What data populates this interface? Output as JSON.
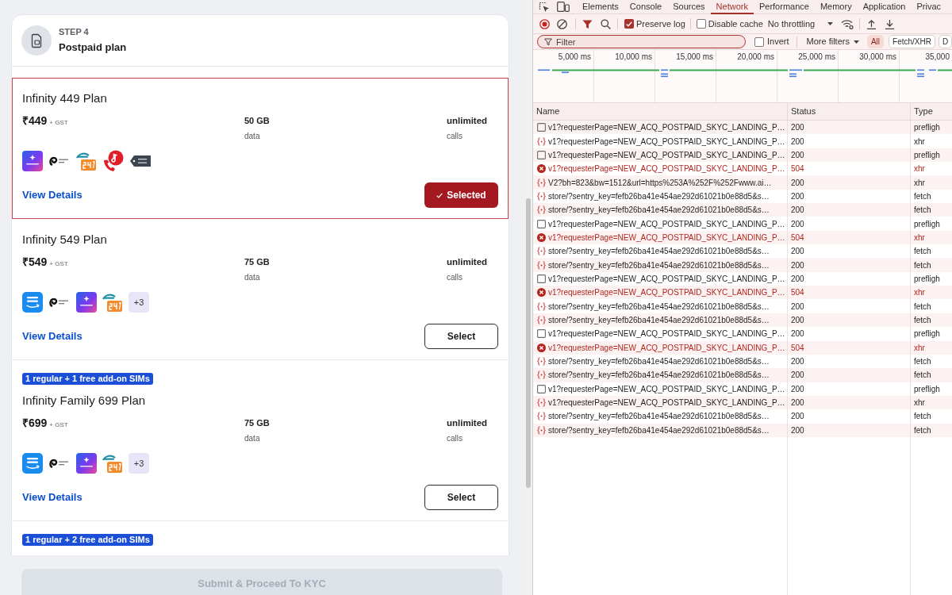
{
  "page": {
    "step": {
      "label": "STEP 4",
      "title": "Postpaid plan"
    },
    "plans": [
      {
        "selected": true,
        "name": "Infinity 449 Plan",
        "price": "₹449",
        "tax": "+ GST",
        "data": {
          "value": "50 GB",
          "label": "data"
        },
        "calls": {
          "value": "unlimited",
          "label": "calls"
        },
        "benefits": [
          {
            "kind": "star"
          },
          {
            "kind": "swirl"
          },
          {
            "kind": "health"
          },
          {
            "kind": "tune"
          },
          {
            "kind": "tag"
          }
        ],
        "link": "View Details",
        "button": "Selected"
      },
      {
        "selected": false,
        "name": "Infinity 549 Plan",
        "price": "₹549",
        "tax": "+ GST",
        "data": {
          "value": "75 GB",
          "label": "data"
        },
        "calls": {
          "value": "unlimited",
          "label": "calls"
        },
        "benefits": [
          {
            "kind": "video"
          },
          {
            "kind": "swirl"
          },
          {
            "kind": "star"
          },
          {
            "kind": "health"
          },
          {
            "kind": "more",
            "text": "+3"
          }
        ],
        "link": "View Details",
        "button": "Select"
      },
      {
        "selected": false,
        "badge": "1 regular + 1 free add-on SIMs",
        "name": "Infinity Family 699 Plan",
        "price": "₹699",
        "tax": "+ GST",
        "data": {
          "value": "75 GB",
          "label": "data"
        },
        "calls": {
          "value": "unlimited",
          "label": "calls"
        },
        "benefits": [
          {
            "kind": "video"
          },
          {
            "kind": "swirl"
          },
          {
            "kind": "star"
          },
          {
            "kind": "health"
          },
          {
            "kind": "more",
            "text": "+3"
          }
        ],
        "link": "View Details",
        "button": "Select"
      },
      {
        "selected": false,
        "badge": "1 regular + 2 free add-on SIMs"
      }
    ],
    "submit": {
      "label": "Submit & Proceed To KYC",
      "disabled": true
    }
  },
  "devtools": {
    "tabs": [
      {
        "label": "Elements",
        "selected": false
      },
      {
        "label": "Console",
        "selected": false
      },
      {
        "label": "Sources",
        "selected": false
      },
      {
        "label": "Network",
        "selected": true
      },
      {
        "label": "Performance",
        "selected": false
      },
      {
        "label": "Memory",
        "selected": false
      },
      {
        "label": "Application",
        "selected": false
      },
      {
        "label": "Privac",
        "selected": false
      }
    ],
    "toolbar": {
      "preserve_log": {
        "label": "Preserve log",
        "checked": true
      },
      "disable_cache": {
        "label": "Disable cache",
        "checked": false
      },
      "throttling": "No throttling"
    },
    "filter": {
      "placeholder": "Filter",
      "invert": {
        "label": "Invert",
        "checked": false
      },
      "more_filters": "More filters",
      "types": [
        {
          "label": "All",
          "selected": true
        },
        {
          "label": "Fetch/XHR",
          "selected": false
        },
        {
          "label": "D",
          "selected": false
        }
      ]
    },
    "timeline": {
      "ticks": [
        "5,000 ms",
        "10,000 ms",
        "15,000 ms",
        "20,000 ms",
        "25,000 ms",
        "30,000 ms",
        "35,000"
      ]
    },
    "table": {
      "columns": [
        "Name",
        "Status",
        "Type"
      ],
      "rows": [
        {
          "kind": "preflight",
          "name": "v1?requesterPage=NEW_ACQ_POSTPAID_SKYC_LANDING_P…",
          "status": "200",
          "type": "prefligh"
        },
        {
          "kind": "script",
          "name": "v1?requesterPage=NEW_ACQ_POSTPAID_SKYC_LANDING_P…",
          "status": "200",
          "type": "xhr"
        },
        {
          "kind": "preflight",
          "name": "v1?requesterPage=NEW_ACQ_POSTPAID_SKYC_LANDING_P…",
          "status": "200",
          "type": "prefligh"
        },
        {
          "kind": "failed",
          "name": "v1?requesterPage=NEW_ACQ_POSTPAID_SKYC_LANDING_P…",
          "status": "504",
          "type": "xhr"
        },
        {
          "kind": "script",
          "name": "V2?bh=823&bw=1512&url=https%253A%252F%252Fwww.ai…",
          "status": "200",
          "type": "xhr"
        },
        {
          "kind": "script",
          "name": "store/?sentry_key=fefb26ba41e454ae292d61021b0e88d5&s…",
          "status": "200",
          "type": "fetch"
        },
        {
          "kind": "script",
          "name": "store/?sentry_key=fefb26ba41e454ae292d61021b0e88d5&s…",
          "status": "200",
          "type": "fetch"
        },
        {
          "kind": "preflight",
          "name": "v1?requesterPage=NEW_ACQ_POSTPAID_SKYC_LANDING_P…",
          "status": "200",
          "type": "prefligh"
        },
        {
          "kind": "failed",
          "name": "v1?requesterPage=NEW_ACQ_POSTPAID_SKYC_LANDING_P…",
          "status": "504",
          "type": "xhr"
        },
        {
          "kind": "script",
          "name": "store/?sentry_key=fefb26ba41e454ae292d61021b0e88d5&s…",
          "status": "200",
          "type": "fetch"
        },
        {
          "kind": "script",
          "name": "store/?sentry_key=fefb26ba41e454ae292d61021b0e88d5&s…",
          "status": "200",
          "type": "fetch"
        },
        {
          "kind": "preflight",
          "name": "v1?requesterPage=NEW_ACQ_POSTPAID_SKYC_LANDING_P…",
          "status": "200",
          "type": "prefligh"
        },
        {
          "kind": "failed",
          "name": "v1?requesterPage=NEW_ACQ_POSTPAID_SKYC_LANDING_P…",
          "status": "504",
          "type": "xhr"
        },
        {
          "kind": "script",
          "name": "store/?sentry_key=fefb26ba41e454ae292d61021b0e88d5&s…",
          "status": "200",
          "type": "fetch"
        },
        {
          "kind": "script",
          "name": "store/?sentry_key=fefb26ba41e454ae292d61021b0e88d5&s…",
          "status": "200",
          "type": "fetch"
        },
        {
          "kind": "preflight",
          "name": "v1?requesterPage=NEW_ACQ_POSTPAID_SKYC_LANDING_P…",
          "status": "200",
          "type": "prefligh"
        },
        {
          "kind": "failed",
          "name": "v1?requesterPage=NEW_ACQ_POSTPAID_SKYC_LANDING_P…",
          "status": "504",
          "type": "xhr"
        },
        {
          "kind": "script",
          "name": "store/?sentry_key=fefb26ba41e454ae292d61021b0e88d5&s…",
          "status": "200",
          "type": "fetch"
        },
        {
          "kind": "script",
          "name": "store/?sentry_key=fefb26ba41e454ae292d61021b0e88d5&s…",
          "status": "200",
          "type": "fetch"
        },
        {
          "kind": "preflight",
          "name": "v1?requesterPage=NEW_ACQ_POSTPAID_SKYC_LANDING_P…",
          "status": "200",
          "type": "prefligh"
        },
        {
          "kind": "script",
          "name": "v1?requesterPage=NEW_ACQ_POSTPAID_SKYC_LANDING_P…",
          "status": "200",
          "type": "xhr"
        },
        {
          "kind": "script",
          "name": "store/?sentry_key=fefb26ba41e454ae292d61021b0e88d5&s…",
          "status": "200",
          "type": "fetch"
        },
        {
          "kind": "script",
          "name": "store/?sentry_key=fefb26ba41e454ae292d61021b0e88d5&s…",
          "status": "200",
          "type": "fetch"
        }
      ]
    }
  }
}
